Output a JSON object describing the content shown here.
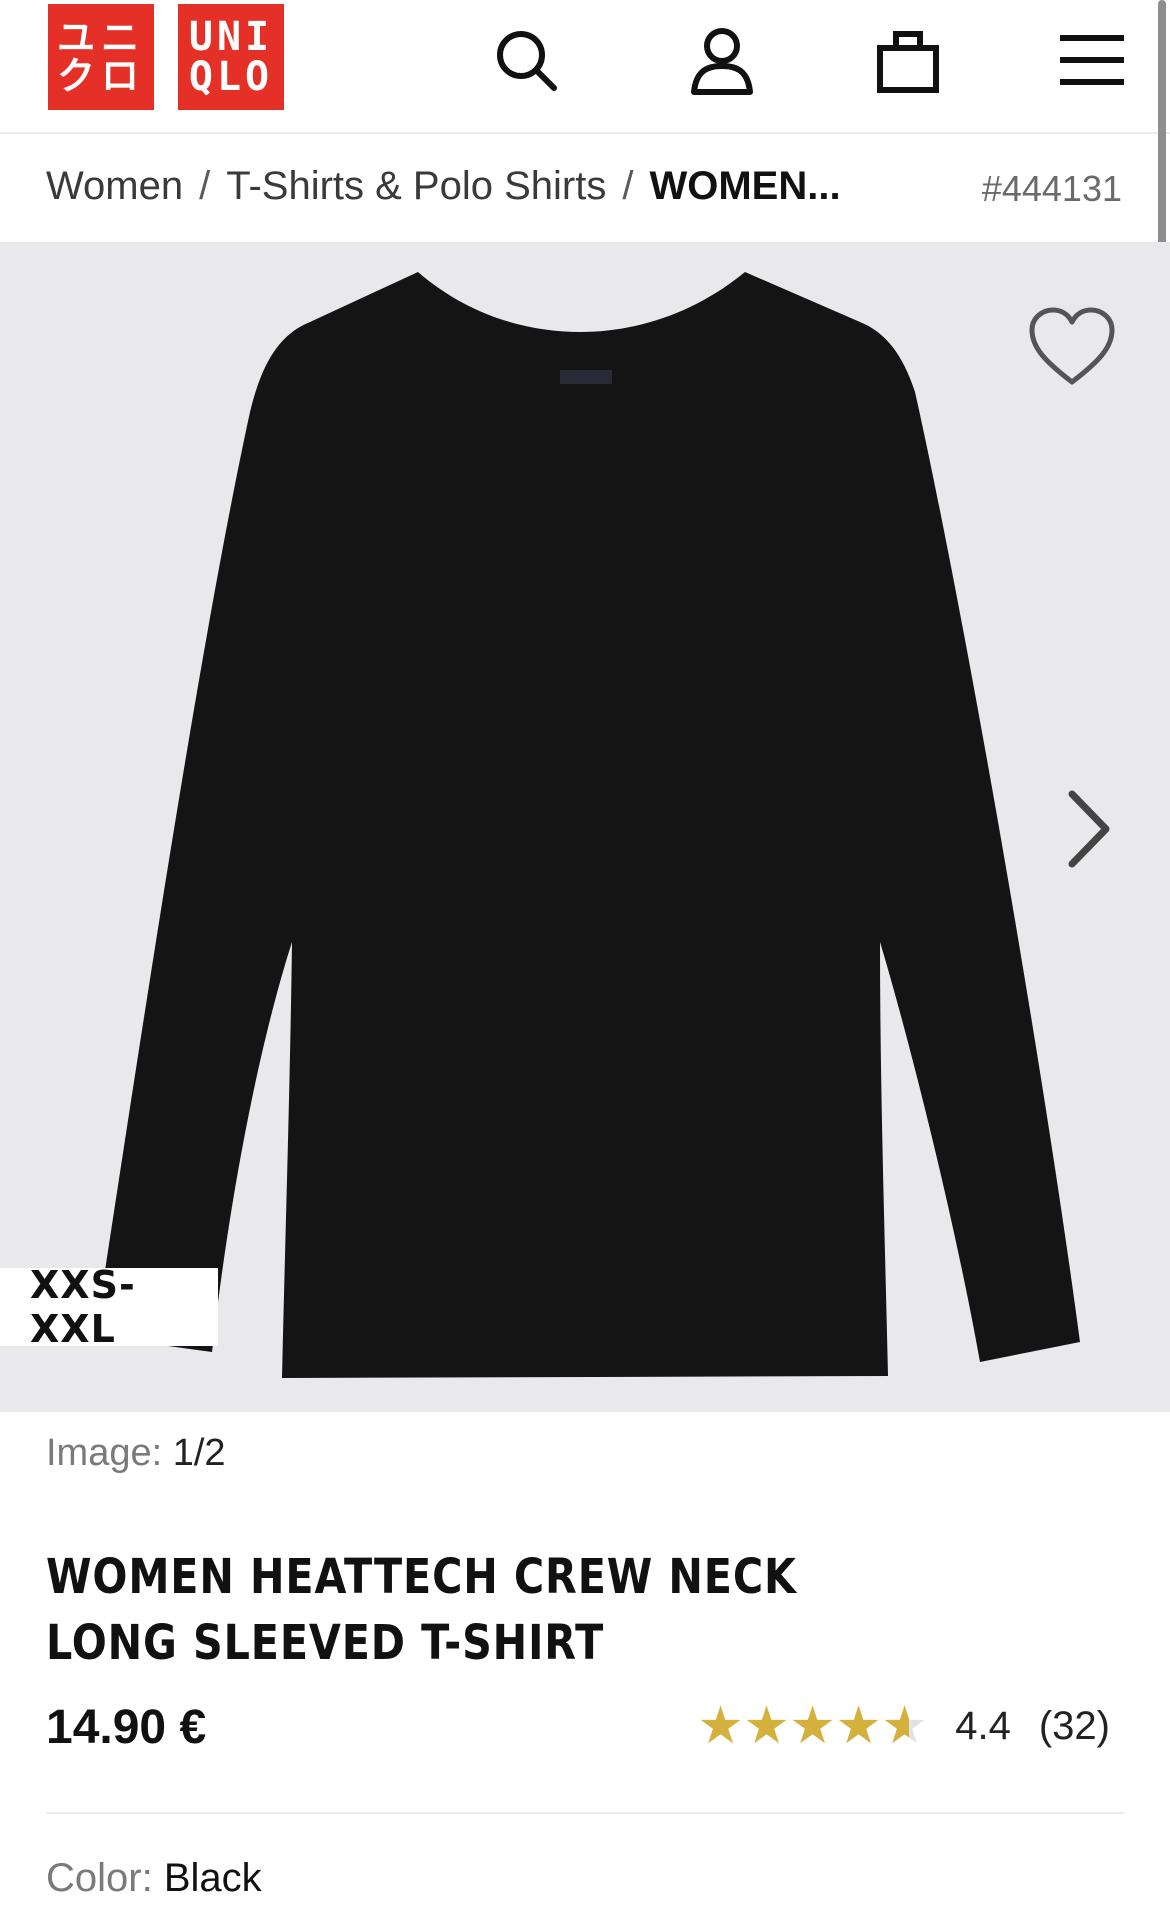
{
  "header": {
    "logo_top": "UNI",
    "logo_bottom": "QLO",
    "logo_kana_top": "ユニ",
    "logo_kana_bottom": "クロ",
    "icons": [
      "search-icon",
      "account-icon",
      "cart-icon",
      "menu-icon"
    ]
  },
  "breadcrumb": {
    "items": [
      "Women",
      "T-Shirts & Polo Shirts",
      "WOMEN..."
    ],
    "separator": "/",
    "product_id": "#444131"
  },
  "gallery": {
    "size_range": "XXS-XXL",
    "image_label": "Image:",
    "image_position": "1/2"
  },
  "product": {
    "title": "WOMEN HEATTECH CREW NECK LONG SLEEVED T-SHIRT",
    "price": "14.90 €",
    "rating_value": "4.4",
    "review_count": "(32)",
    "rating_numeric": 4.4,
    "color_label": "Color:",
    "color_value": "Black"
  },
  "colors": {
    "brand_red": "#e53027",
    "star_gold": "#d4b13c",
    "image_bg": "#e9e9eb",
    "shirt": "#141414"
  }
}
